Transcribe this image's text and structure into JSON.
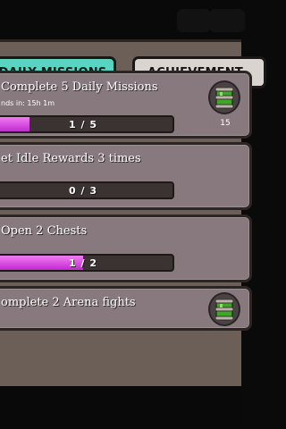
{
  "tabs": {
    "daily": "DAILY MISSIONS",
    "achievements": "ACHIEVEMENT"
  },
  "missions": [
    {
      "title": "Complete 5 Daily Missions",
      "timer": "nds in: 15h 1m",
      "progress": "1 / 5",
      "fraction": 0.2,
      "reward_count": "15",
      "reward_icon": "green-barrel-icon"
    },
    {
      "title": "et Idle Rewards 3 times",
      "progress": "0 / 3",
      "fraction": 0
    },
    {
      "title": "Open 2 Chests",
      "progress": "1 / 2",
      "fraction": 0.5
    },
    {
      "title": "omplete 2 Arena fights",
      "reward_icon": "green-barrel-icon"
    }
  ],
  "colors": {
    "active_tab": "#59d3c2",
    "progress_fill": "#d63fe0",
    "card": "#87797d"
  }
}
